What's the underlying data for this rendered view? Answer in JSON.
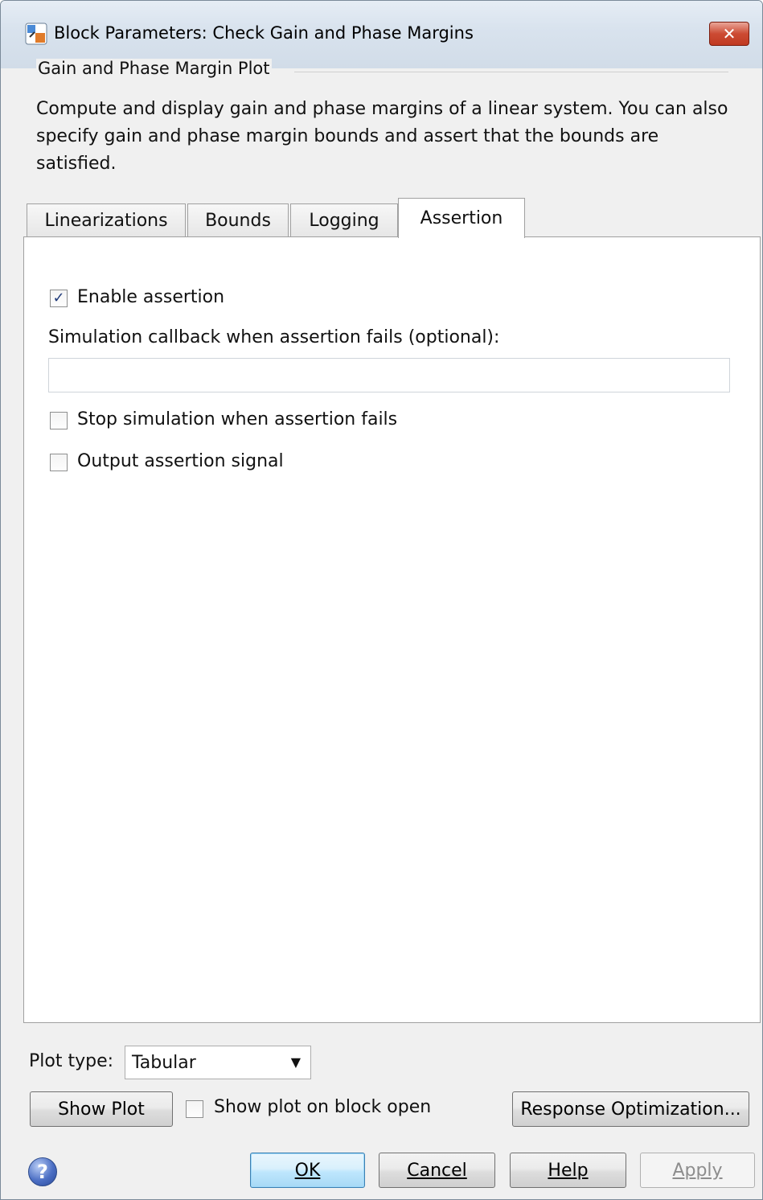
{
  "window": {
    "title": "Block Parameters: Check Gain and Phase Margins",
    "close_label": "✕"
  },
  "group": {
    "label": "Gain and Phase Margin Plot",
    "description": "Compute and display gain and phase margins of a linear system. You can also specify gain and phase margin bounds and assert that the bounds are satisfied."
  },
  "tabs": [
    {
      "label": "Linearizations",
      "active": false
    },
    {
      "label": "Bounds",
      "active": false
    },
    {
      "label": "Logging",
      "active": false
    },
    {
      "label": "Assertion",
      "active": true
    }
  ],
  "assertion": {
    "enable_label": "Enable assertion",
    "enable_checked": true,
    "callback_label": "Simulation callback when assertion fails (optional):",
    "callback_value": "",
    "stop_label": "Stop simulation when assertion fails",
    "stop_checked": false,
    "output_label": "Output assertion signal",
    "output_checked": false
  },
  "bottom": {
    "plot_type_label": "Plot type:",
    "plot_type_value": "Tabular",
    "show_plot_label": "Show Plot",
    "show_on_open_label": "Show plot on block open",
    "show_on_open_checked": false,
    "response_opt_label": "Response Optimization..."
  },
  "buttons": {
    "ok": "OK",
    "cancel": "Cancel",
    "help": "Help",
    "apply": "Apply"
  },
  "colors": {
    "accent": "#3c7fb1",
    "close": "#c03a22",
    "check": "#1f3a7a"
  }
}
